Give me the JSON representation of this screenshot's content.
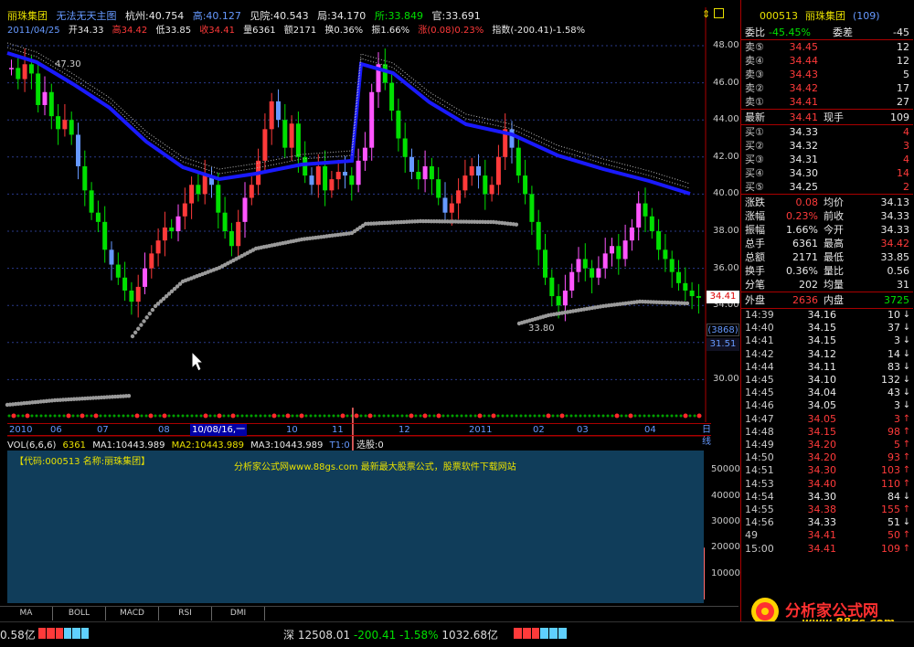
{
  "header": {
    "stock_name": "丽珠集团",
    "mode_label": "无法无天主图",
    "hangzhou": "杭州:40.754",
    "high_cyan": "高:40.127",
    "jianyuan": "见院:40.543",
    "ju": "局:34.170",
    "suo": "所:33.849",
    "guan": "官:33.691"
  },
  "bar_info": {
    "date": "2011/04/25",
    "open": "开34.33",
    "high": "高34.42",
    "low": "低33.85",
    "close": "收34.41",
    "volume": "量6361",
    "amount": "额2171",
    "turnover": "换0.36%",
    "amplitude": "振1.66%",
    "change": "涨(0.08)0.23%",
    "index": "指数(-200.41)-1.58%"
  },
  "price_axis": [
    "48.00",
    "46.00",
    "44.00",
    "42.00",
    "40.00",
    "38.00",
    "36.00",
    "34.00",
    "32.00",
    "30.00"
  ],
  "chart_annotations": {
    "peak_label": "47.30",
    "low_label": "33.80",
    "current_tag": "34.41",
    "count_tag": "(3868)",
    "price_tag2": "31.51"
  },
  "time_axis": [
    "2010",
    "06",
    "07",
    "08",
    "10/08/16,一",
    "10",
    "11",
    "12",
    "2011",
    "02",
    "03",
    "04",
    "日线"
  ],
  "volume_header": {
    "name": "VOL(6,6,6)",
    "vol": "6361",
    "ma1": "MA1:10443.989",
    "ma2": "MA2:10443.989",
    "ma3": "MA3:10443.989",
    "t1": "T1:0",
    "pick": "选股:0"
  },
  "vol_watermark": "【代码:000513 名称:丽珠集团】",
  "vol_watermark2": "分析家公式网www.88gs.com 最新最大股票公式，股票软件下载网站",
  "vol_axis": [
    "50000",
    "40000",
    "30000",
    "20000",
    "10000"
  ],
  "tabs": [
    "MA",
    "BOLL",
    "MACD",
    "RSI",
    "DMI"
  ],
  "quote": {
    "code": "000513",
    "name": "丽珠集团",
    "count": "(109)",
    "weibi_label": "委比",
    "weibi": "-45.45%",
    "weicha_label": "委差",
    "weicha": "-45",
    "sells": [
      {
        "label": "卖⑤",
        "price": "34.45",
        "vol": "12"
      },
      {
        "label": "卖④",
        "price": "34.44",
        "vol": "12"
      },
      {
        "label": "卖③",
        "price": "34.43",
        "vol": "5"
      },
      {
        "label": "卖②",
        "price": "34.42",
        "vol": "17"
      },
      {
        "label": "卖①",
        "price": "34.41",
        "vol": "27"
      }
    ],
    "last_label": "最新",
    "last": "34.41",
    "hand_label": "现手",
    "hand": "109",
    "buys": [
      {
        "label": "买①",
        "price": "34.33",
        "vol": "4"
      },
      {
        "label": "买②",
        "price": "34.32",
        "vol": "3"
      },
      {
        "label": "买③",
        "price": "34.31",
        "vol": "4"
      },
      {
        "label": "买④",
        "price": "34.30",
        "vol": "14"
      },
      {
        "label": "买⑤",
        "price": "34.25",
        "vol": "2"
      }
    ],
    "stats": [
      {
        "l1": "涨跌",
        "v1": "0.08",
        "l2": "均价",
        "v2": "34.13"
      },
      {
        "l1": "涨幅",
        "v1": "0.23%",
        "l2": "前收",
        "v2": "34.33"
      },
      {
        "l1": "振幅",
        "v1": "1.66%",
        "l2": "今开",
        "v2": "34.33"
      },
      {
        "l1": "总手",
        "v1": "6361",
        "l2": "最高",
        "v2": "34.42"
      },
      {
        "l1": "总额",
        "v1": "2171",
        "l2": "最低",
        "v2": "33.85"
      },
      {
        "l1": "换手",
        "v1": "0.36%",
        "l2": "量比",
        "v2": "0.56"
      },
      {
        "l1": "分笔",
        "v1": "202",
        "l2": "均量",
        "v2": "31"
      }
    ],
    "outer_label": "外盘",
    "outer": "2636",
    "inner_label": "内盘",
    "inner": "3725"
  },
  "ticks": [
    {
      "t": "14:39",
      "p": "34.16",
      "v": "10",
      "d": "dn"
    },
    {
      "t": "14:40",
      "p": "34.15",
      "v": "37",
      "d": "dn"
    },
    {
      "t": "14:41",
      "p": "34.15",
      "v": "3",
      "d": "dn"
    },
    {
      "t": "14:42",
      "p": "34.12",
      "v": "14",
      "d": "dn"
    },
    {
      "t": "14:44",
      "p": "34.11",
      "v": "83",
      "d": "dn"
    },
    {
      "t": "14:45",
      "p": "34.10",
      "v": "132",
      "d": "dn"
    },
    {
      "t": "14:45",
      "p": "34.04",
      "v": "43",
      "d": "dn"
    },
    {
      "t": "14:46",
      "p": "34.05",
      "v": "3",
      "d": "dn"
    },
    {
      "t": "14:47",
      "p": "34.05",
      "v": "3",
      "d": "up"
    },
    {
      "t": "14:48",
      "p": "34.15",
      "v": "98",
      "d": "up"
    },
    {
      "t": "14:49",
      "p": "34.20",
      "v": "5",
      "d": "up"
    },
    {
      "t": "14:50",
      "p": "34.20",
      "v": "93",
      "d": "up"
    },
    {
      "t": "14:51",
      "p": "34.30",
      "v": "103",
      "d": "up"
    },
    {
      "t": "14:53",
      "p": "34.40",
      "v": "110",
      "d": "up"
    },
    {
      "t": "14:54",
      "p": "34.30",
      "v": "84",
      "d": "dn"
    },
    {
      "t": "14:55",
      "p": "34.38",
      "v": "155",
      "d": "up"
    },
    {
      "t": "14:56",
      "p": "34.33",
      "v": "51",
      "d": "dn"
    },
    {
      "t": "49",
      "p": "34.41",
      "v": "50",
      "d": "up"
    },
    {
      "t": "15:00",
      "p": "34.41",
      "v": "109",
      "d": "up"
    }
  ],
  "logo": {
    "text": "分析家公式网",
    "url": "www.88gs.com"
  },
  "status": {
    "left": "0.58亿",
    "shen_label": "深",
    "shen_value": "12508.01",
    "shen_change": "-200.41",
    "shen_pct": "-1.58%",
    "shen_amount": "1032.68亿"
  },
  "colors": {
    "up": "#ff3a3a",
    "down": "#00e000",
    "ma_blue": "#1a1aff",
    "bg": "#000000",
    "vol_bg": "#103d5a"
  }
}
